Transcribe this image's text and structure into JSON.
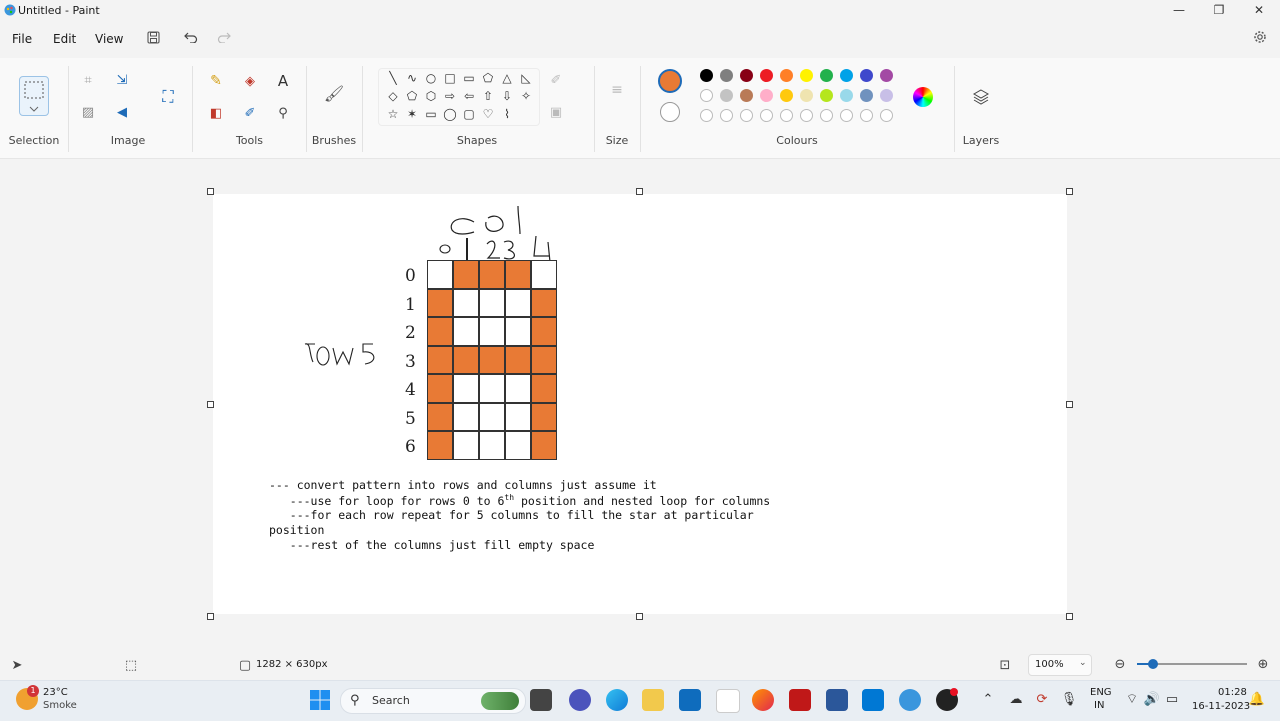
{
  "window": {
    "title": "Untitled - Paint",
    "minimize_glyph": "—",
    "maximize_glyph": "❐",
    "close_glyph": "✕"
  },
  "menu": {
    "file": "File",
    "edit": "Edit",
    "view": "View"
  },
  "toolbar_icons": [
    "save-icon",
    "undo-icon",
    "redo-icon",
    "settings-icon"
  ],
  "ribbon": {
    "groups": {
      "selection": "Selection",
      "image": "Image",
      "tools": "Tools",
      "brushes": "Brushes",
      "shapes": "Shapes",
      "size": "Size",
      "colours": "Colours",
      "layers": "Layers"
    },
    "shape_glyphs": [
      "╲",
      "∿",
      "○",
      "□",
      "▭",
      "⬠",
      "△",
      "◺",
      "◇",
      "⬠",
      "⬡",
      "⇨",
      "⇦",
      "⇧",
      "⇩",
      "✧",
      "☆",
      "✶",
      "▭",
      "◯",
      "▢",
      "♡",
      "⌇"
    ],
    "primary_color": "#e87a35",
    "secondary_color": "#ffffff",
    "palette_row1": [
      "#000000",
      "#7f7f7f",
      "#880015",
      "#ed1c24",
      "#ff7f27",
      "#fff200",
      "#22b14c",
      "#00a2e8",
      "#3f48cc",
      "#a349a4"
    ],
    "palette_row2": [
      "#ffffff",
      "#c3c3c3",
      "#b97a57",
      "#ffaec9",
      "#ffc90e",
      "#efe4b0",
      "#b5e61d",
      "#99d9ea",
      "#7092be",
      "#c8bfe7"
    ]
  },
  "canvas": {
    "accent_fill": "#e87a35",
    "col_label": "col",
    "col_numbers": "0 1 2 3 4",
    "rows_label": "rows",
    "row_numbers": [
      "0",
      "1",
      "2",
      "3",
      "4",
      "5",
      "6"
    ],
    "grid_pattern": [
      [
        0,
        1,
        1,
        1,
        0
      ],
      [
        1,
        0,
        0,
        0,
        1
      ],
      [
        1,
        0,
        0,
        0,
        1
      ],
      [
        1,
        1,
        1,
        1,
        1
      ],
      [
        1,
        0,
        0,
        0,
        1
      ],
      [
        1,
        0,
        0,
        0,
        1
      ],
      [
        1,
        0,
        0,
        0,
        1
      ]
    ],
    "notes": {
      "line1": "--- convert pattern into rows and columns just assume it",
      "line2_a": "   ---use for loop for rows 0 to 6",
      "line2_sup": "th",
      "line2_b": " position and nested loop for columns",
      "line3": "   ---for each row repeat for 5 columns to fill the star at particular",
      "line4": "position",
      "line5": "   ---rest of the columns just fill empty space"
    }
  },
  "statusbar": {
    "canvas_size": "1282 × 630px",
    "zoom": "100%"
  },
  "taskbar": {
    "weather_temp": "23°C",
    "weather_desc": "Smoke",
    "weather_badge": "1",
    "search_placeholder": "Search",
    "lang_top": "ENG",
    "lang_bottom": "IN",
    "time": "01:28",
    "date": "16-11-2023"
  }
}
